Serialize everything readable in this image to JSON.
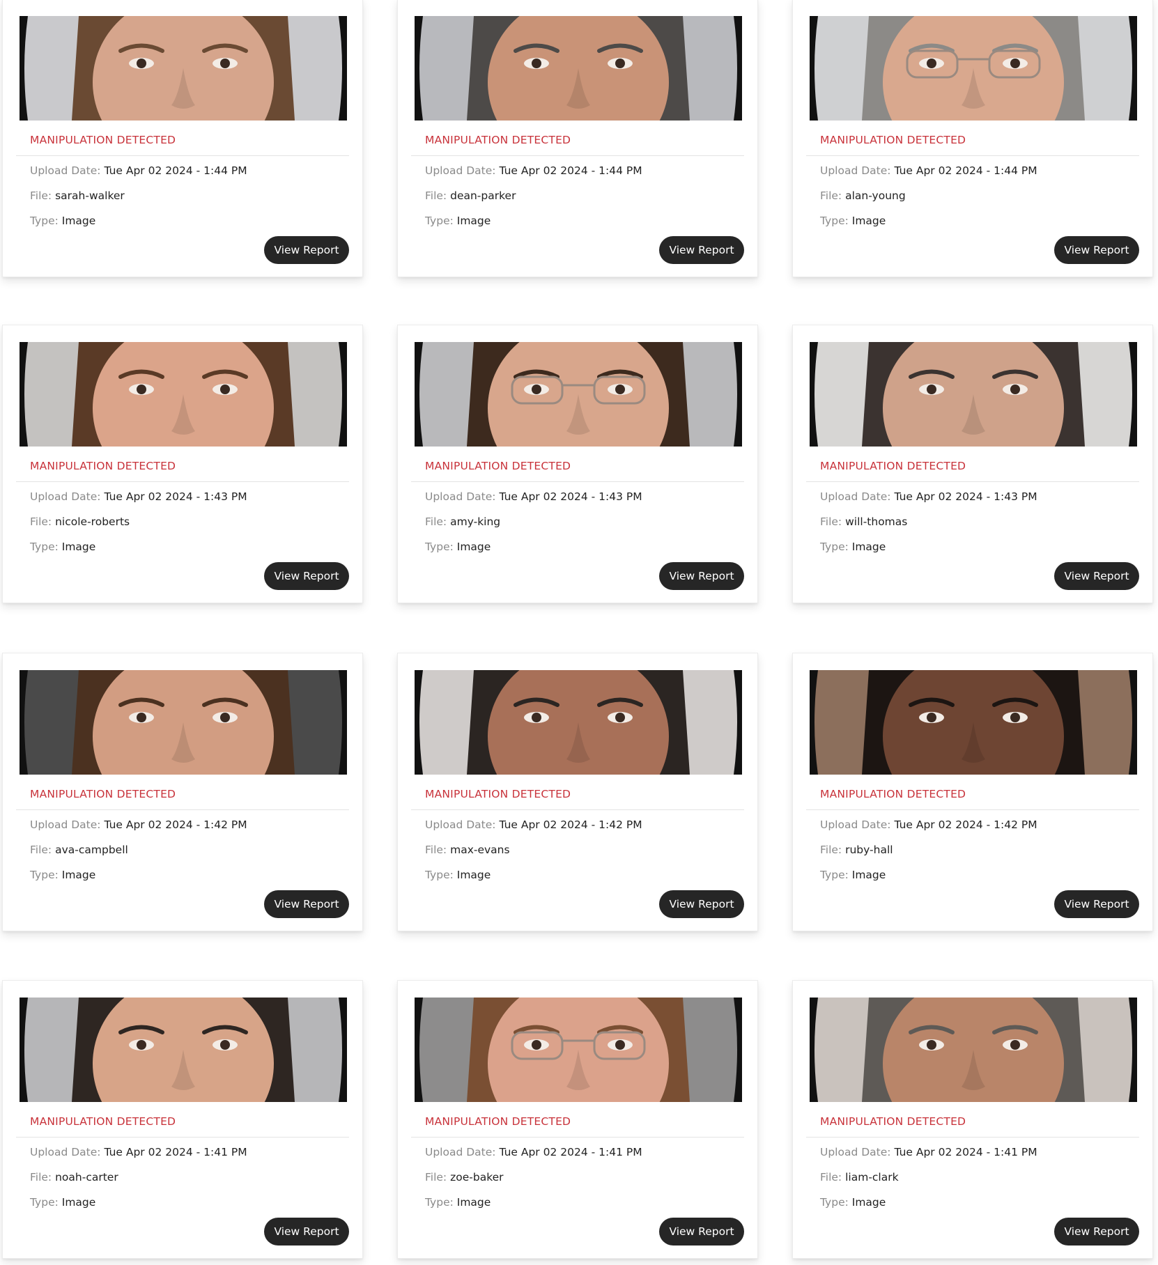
{
  "cards": [
    {
      "status": "MANIPULATION DETECTED",
      "date_label": "Upload Date:",
      "date": "Tue Apr 02 2024 - 1:44 PM",
      "file_label": "File:",
      "file": "sarah-walker",
      "type_label": "Type:",
      "type": "Image",
      "button": "View Report",
      "photo": {
        "bg": "#c9c9cc",
        "skin": "#d6a58c",
        "hair": "#6a4a33",
        "glasses": false
      }
    },
    {
      "status": "MANIPULATION DETECTED",
      "date_label": "Upload Date:",
      "date": "Tue Apr 02 2024 - 1:44 PM",
      "file_label": "File:",
      "file": "dean-parker",
      "type_label": "Type:",
      "type": "Image",
      "button": "View Report",
      "photo": {
        "bg": "#b8b9bd",
        "skin": "#c99377",
        "hair": "#4d4a48",
        "glasses": false
      }
    },
    {
      "status": "MANIPULATION DETECTED",
      "date_label": "Upload Date:",
      "date": "Tue Apr 02 2024 - 1:44 PM",
      "file_label": "File:",
      "file": "alan-young",
      "type_label": "Type:",
      "type": "Image",
      "button": "View Report",
      "photo": {
        "bg": "#cfd0d2",
        "skin": "#d9a88e",
        "hair": "#8c8a87",
        "glasses": true
      }
    },
    {
      "status": "MANIPULATION DETECTED",
      "date_label": "Upload Date:",
      "date": "Tue Apr 02 2024 - 1:43 PM",
      "file_label": "File:",
      "file": "nicole-roberts",
      "type_label": "Type:",
      "type": "Image",
      "button": "View Report",
      "photo": {
        "bg": "#c4c2c0",
        "skin": "#dba48a",
        "hair": "#5a3a26",
        "glasses": false
      }
    },
    {
      "status": "MANIPULATION DETECTED",
      "date_label": "Upload Date:",
      "date": "Tue Apr 02 2024 - 1:43 PM",
      "file_label": "File:",
      "file": "amy-king",
      "type_label": "Type:",
      "type": "Image",
      "button": "View Report",
      "photo": {
        "bg": "#b9b9bb",
        "skin": "#d8a68c",
        "hair": "#3d2a1e",
        "glasses": true
      }
    },
    {
      "status": "MANIPULATION DETECTED",
      "date_label": "Upload Date:",
      "date": "Tue Apr 02 2024 - 1:43 PM",
      "file_label": "File:",
      "file": "will-thomas",
      "type_label": "Type:",
      "type": "Image",
      "button": "View Report",
      "photo": {
        "bg": "#d7d6d4",
        "skin": "#cfa28a",
        "hair": "#3b3330",
        "glasses": false
      }
    },
    {
      "status": "MANIPULATION DETECTED",
      "date_label": "Upload Date:",
      "date": "Tue Apr 02 2024 - 1:42 PM",
      "file_label": "File:",
      "file": "ava-campbell",
      "type_label": "Type:",
      "type": "Image",
      "button": "View Report",
      "photo": {
        "bg": "#4a4a4a",
        "skin": "#d29d82",
        "hair": "#4b3120",
        "glasses": false
      }
    },
    {
      "status": "MANIPULATION DETECTED",
      "date_label": "Upload Date:",
      "date": "Tue Apr 02 2024 - 1:42 PM",
      "file_label": "File:",
      "file": "max-evans",
      "type_label": "Type:",
      "type": "Image",
      "button": "View Report",
      "photo": {
        "bg": "#cfcbc9",
        "skin": "#a87058",
        "hair": "#2b2522",
        "glasses": false
      }
    },
    {
      "status": "MANIPULATION DETECTED",
      "date_label": "Upload Date:",
      "date": "Tue Apr 02 2024 - 1:42 PM",
      "file_label": "File:",
      "file": "ruby-hall",
      "type_label": "Type:",
      "type": "Image",
      "button": "View Report",
      "photo": {
        "bg": "#8c6f5c",
        "skin": "#6e4533",
        "hair": "#1c1512",
        "glasses": false
      }
    },
    {
      "status": "MANIPULATION DETECTED",
      "date_label": "Upload Date:",
      "date": "Tue Apr 02 2024 - 1:41 PM",
      "file_label": "File:",
      "file": "noah-carter",
      "type_label": "Type:",
      "type": "Image",
      "button": "View Report",
      "photo": {
        "bg": "#b6b6b8",
        "skin": "#d7a488",
        "hair": "#2e2622",
        "glasses": false
      }
    },
    {
      "status": "MANIPULATION DETECTED",
      "date_label": "Upload Date:",
      "date": "Tue Apr 02 2024 - 1:41 PM",
      "file_label": "File:",
      "file": "zoe-baker",
      "type_label": "Type:",
      "type": "Image",
      "button": "View Report",
      "photo": {
        "bg": "#8d8c8c",
        "skin": "#dba28b",
        "hair": "#7a4f33",
        "glasses": true
      }
    },
    {
      "status": "MANIPULATION DETECTED",
      "date_label": "Upload Date:",
      "date": "Tue Apr 02 2024 - 1:41 PM",
      "file_label": "File:",
      "file": "liam-clark",
      "type_label": "Type:",
      "type": "Image",
      "button": "View Report",
      "photo": {
        "bg": "#c9c2bd",
        "skin": "#b98569",
        "hair": "#5e5a56",
        "glasses": false
      }
    }
  ]
}
